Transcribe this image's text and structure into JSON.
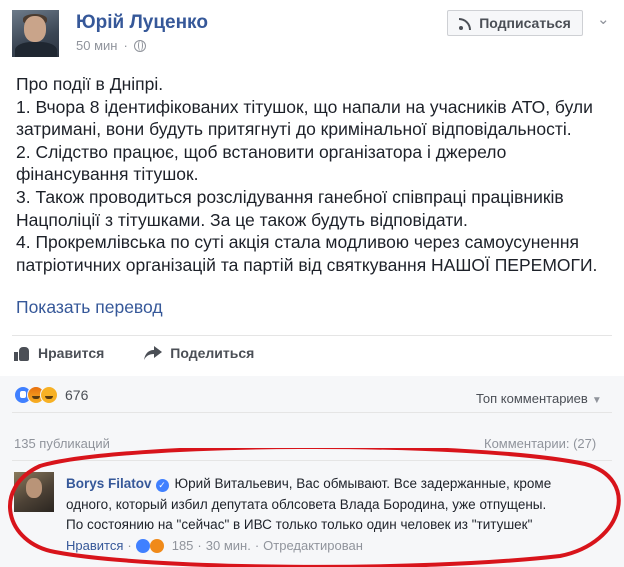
{
  "post": {
    "author": "Юрій Луценко",
    "time": "50 мин",
    "subscribe_label": "Подписаться",
    "lines": [
      "Про події в Дніпрі.",
      "1. Вчора 8 ідентифікованих тітушок, що напали на учасників АТО, були",
      "затримані, вони будуть притягнуті до кримінальної відповідальності.",
      "2. Слідство працює, щоб встановити організатора і джерело",
      "фінансування тітушок.",
      "3. Також проводиться розслідування ганебної співпраці працівників",
      "Нацполіції з тітушками. За це також будуть відповідати.",
      "4. Прокремлівська по суті акція стала модливою через самоусунення",
      "патріотичних організацій та партій від святкування НАШОЇ ПЕРЕМОГИ."
    ],
    "translate_label": "Показать перевод"
  },
  "actions": {
    "like_label": "Нравится",
    "share_label": "Поделиться"
  },
  "reactions": {
    "count": "676",
    "top_comments_label": "Топ комментариев",
    "publications": "135 публикаций",
    "comments_count": "Комментарии: (27)"
  },
  "comment": {
    "author": "Borys Filatov",
    "line1": "Юрий Витальевич, Вас обмывают. Все задержанные, кроме",
    "line2": "одного, который избил депутата облсовета Влада Бородина, уже отпущены.",
    "line3": "По состоянию на \"сейчас\" в ИВС только только один человек из \"титушек\"",
    "like_label": "Нравится",
    "reaction_count": "185",
    "time": "30 мин.",
    "edited": "Отредактирован",
    "separator": "·"
  },
  "colors": {
    "link": "#365899",
    "annotation": "#d8141b",
    "panel": "#f6f7f9"
  }
}
